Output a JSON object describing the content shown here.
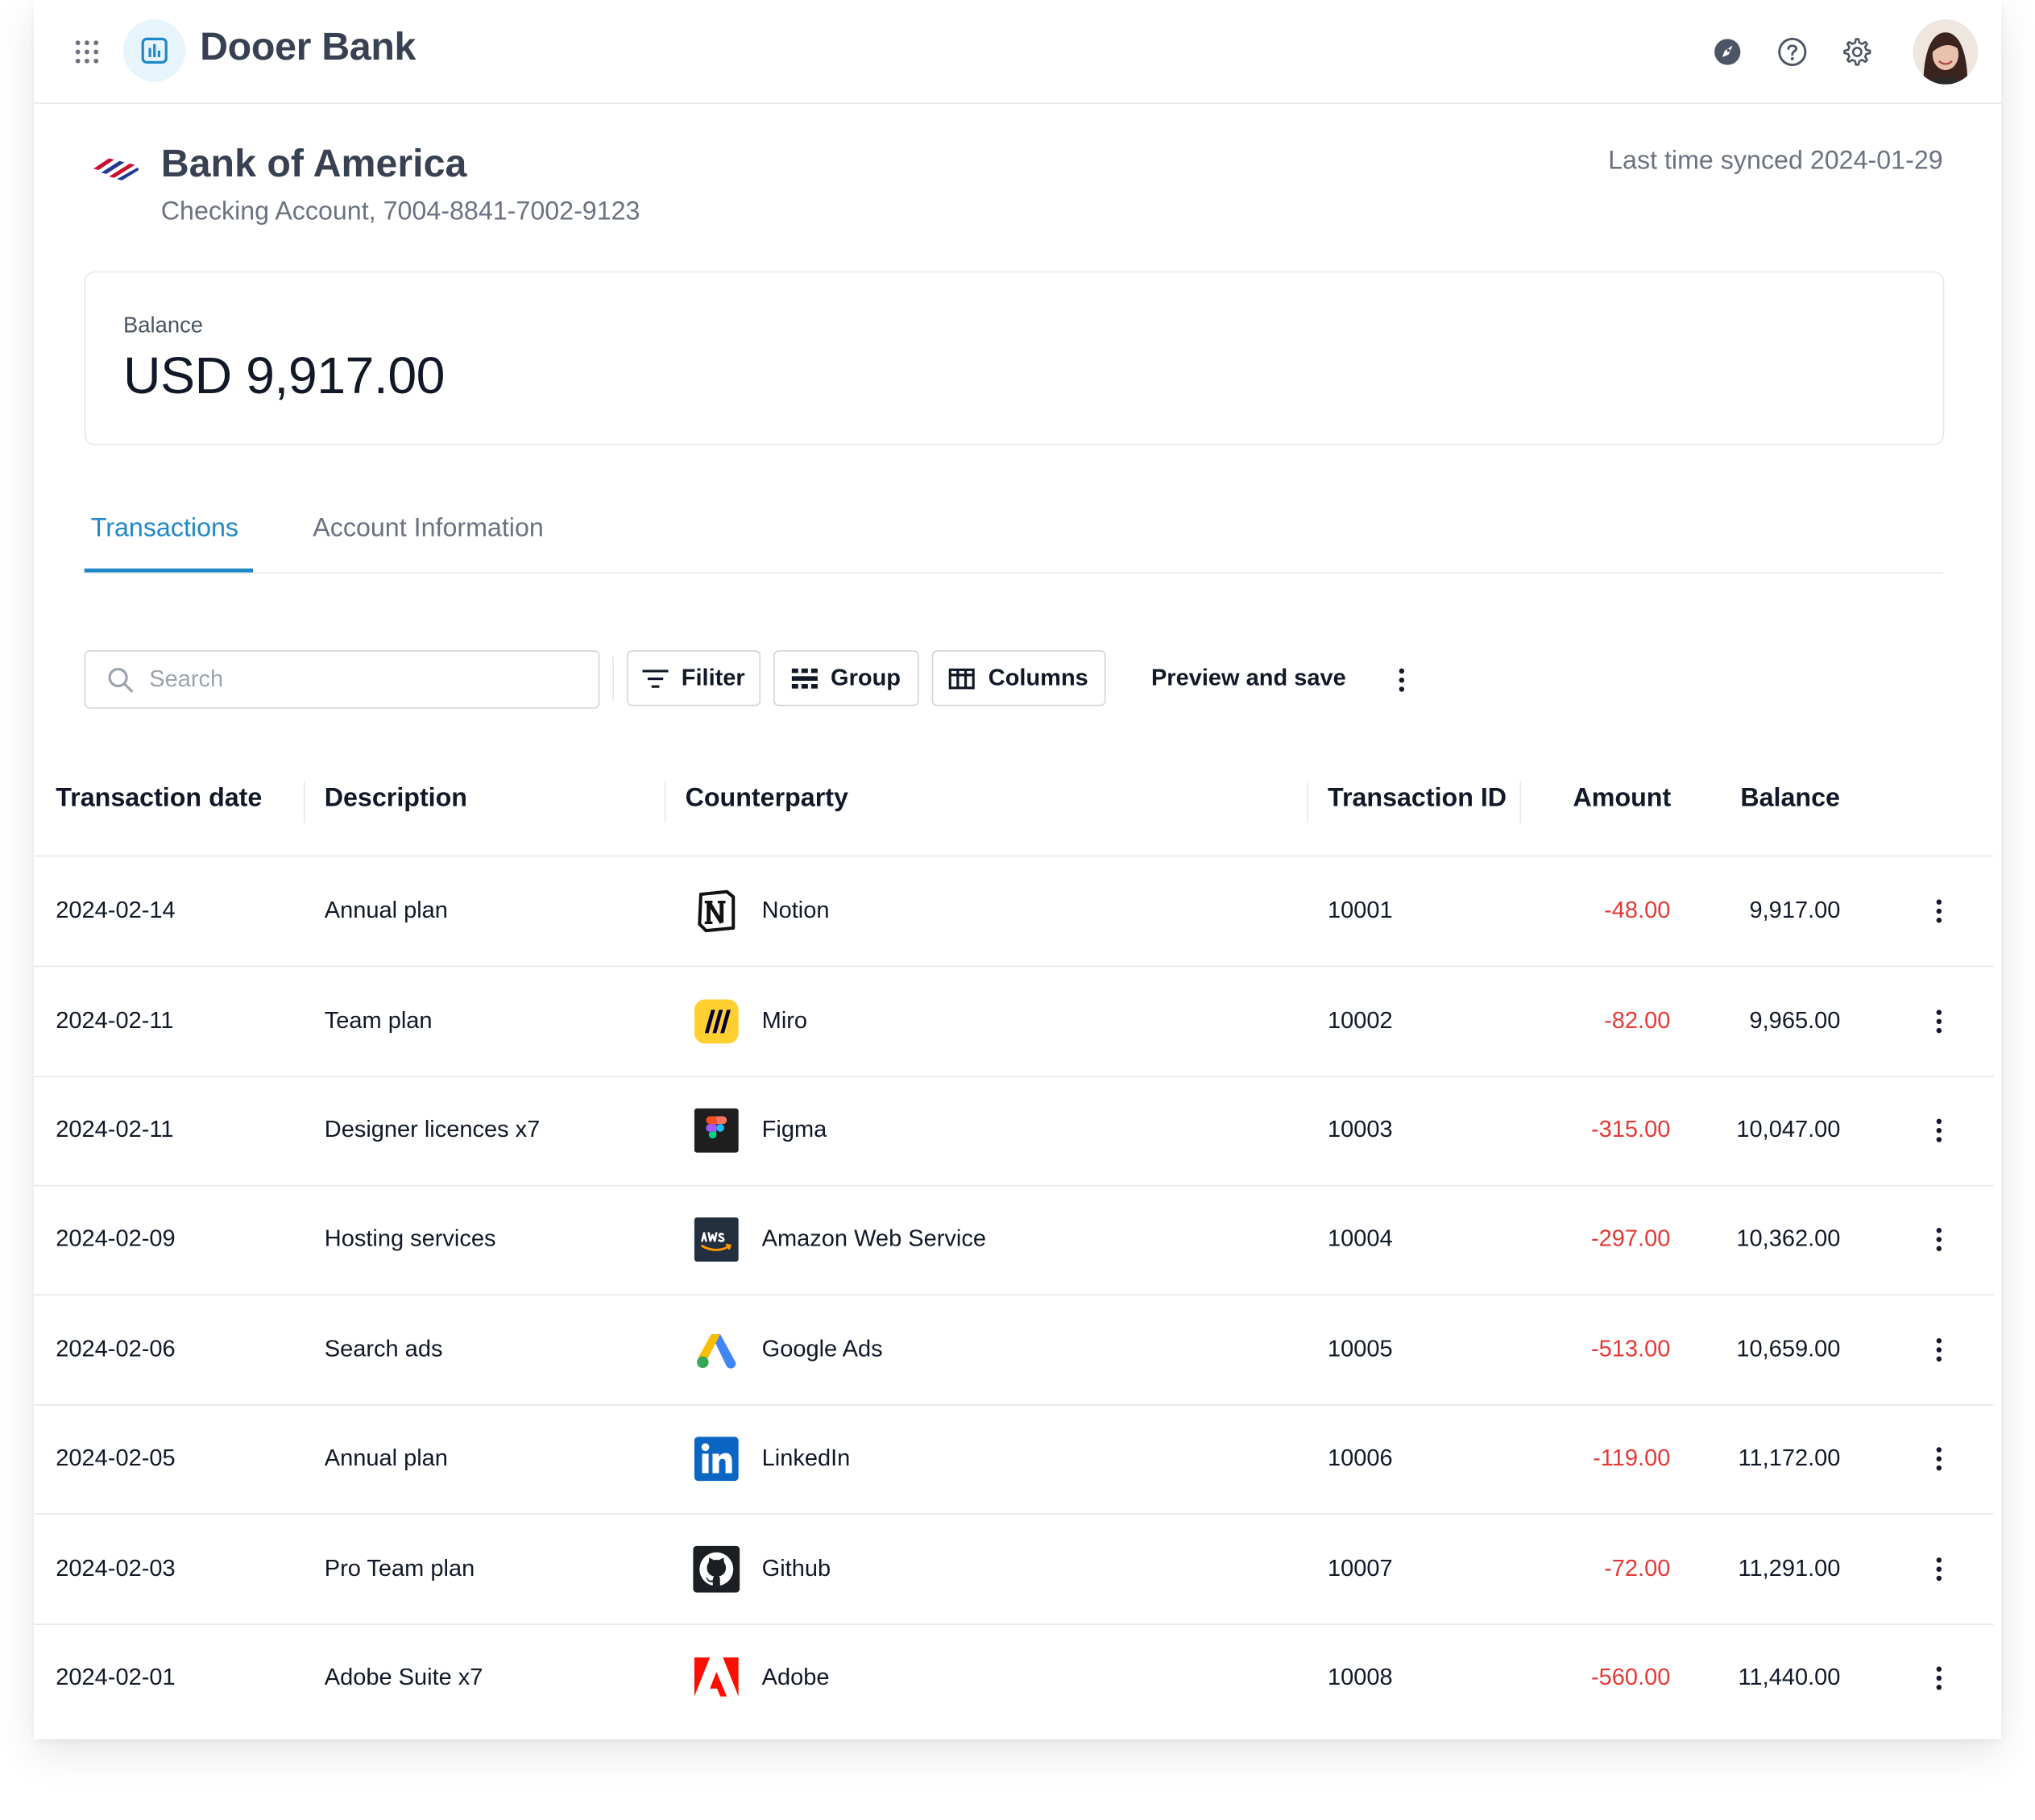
{
  "app": {
    "name": "Dooer Bank"
  },
  "topbar": {
    "icons": [
      "apps-grid-icon",
      "brand-chart-icon",
      "rocket-icon",
      "help-icon",
      "gear-icon",
      "avatar"
    ]
  },
  "account": {
    "bank_name": "Bank of America",
    "subtitle": "Checking Account, 7004-8841-7002-9123",
    "last_synced": "Last time synced 2024-01-29"
  },
  "balance": {
    "label": "Balance",
    "value": "USD 9,917.00"
  },
  "tabs": [
    {
      "label": "Transactions",
      "active": true
    },
    {
      "label": "Account Information",
      "active": false
    }
  ],
  "toolbar": {
    "search_placeholder": "Search",
    "filter_label": "Filiter",
    "group_label": "Group",
    "columns_label": "Columns",
    "preview_label": "Preview and save"
  },
  "table": {
    "headers": [
      "Transaction date",
      "Description",
      "Counterparty",
      "Transaction ID",
      "Amount",
      "Balance"
    ],
    "rows": [
      {
        "date": "2024-02-14",
        "description": "Annual plan",
        "counterparty": "Notion",
        "logo": "notion-icon",
        "id": "10001",
        "amount": "-48.00",
        "balance": "9,917.00"
      },
      {
        "date": "2024-02-11",
        "description": "Team plan",
        "counterparty": "Miro",
        "logo": "miro-icon",
        "id": "10002",
        "amount": "-82.00",
        "balance": "9,965.00"
      },
      {
        "date": "2024-02-11",
        "description": "Designer licences x7",
        "counterparty": "Figma",
        "logo": "figma-icon",
        "id": "10003",
        "amount": "-315.00",
        "balance": "10,047.00"
      },
      {
        "date": "2024-02-09",
        "description": "Hosting services",
        "counterparty": "Amazon Web Service",
        "logo": "aws-icon",
        "id": "10004",
        "amount": "-297.00",
        "balance": "10,362.00"
      },
      {
        "date": "2024-02-06",
        "description": "Search ads",
        "counterparty": "Google Ads",
        "logo": "google-ads-icon",
        "id": "10005",
        "amount": "-513.00",
        "balance": "10,659.00"
      },
      {
        "date": "2024-02-05",
        "description": "Annual plan",
        "counterparty": "LinkedIn",
        "logo": "linkedin-icon",
        "id": "10006",
        "amount": "-119.00",
        "balance": "11,172.00"
      },
      {
        "date": "2024-02-03",
        "description": "Pro Team plan",
        "counterparty": "Github",
        "logo": "github-icon",
        "id": "10007",
        "amount": "-72.00",
        "balance": "11,291.00"
      },
      {
        "date": "2024-02-01",
        "description": "Adobe Suite x7",
        "counterparty": "Adobe",
        "logo": "adobe-icon",
        "id": "10008",
        "amount": "-560.00",
        "balance": "11,440.00"
      }
    ]
  },
  "colors": {
    "accent": "#1e88c8",
    "negative": "#e53935",
    "border": "#e5e7eb"
  }
}
